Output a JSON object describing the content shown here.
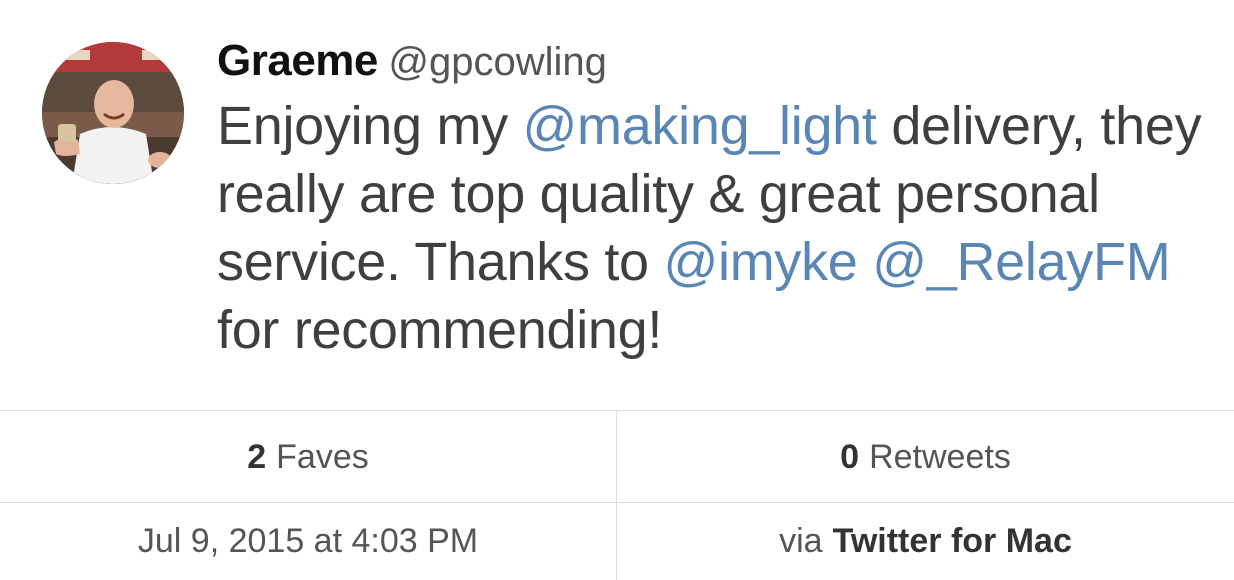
{
  "tweet": {
    "author": {
      "name": "Graeme",
      "handle": "@gpcowling"
    },
    "text": {
      "part1": "Enjoying my ",
      "mention1": "@making_light",
      "part2": " delivery, they really are top quality & great personal service. Thanks to ",
      "mention2": "@imyke",
      "part3": " ",
      "mention3": "@_RelayFM",
      "part4": " for recommending!"
    },
    "stats": {
      "faves_count": "2",
      "faves_label": "Faves",
      "retweets_count": "0",
      "retweets_label": "Retweets"
    },
    "meta": {
      "timestamp": "Jul 9, 2015 at 4:03 PM",
      "via_label": "via",
      "client": "Twitter for Mac"
    }
  },
  "colors": {
    "mention": "#5a86b6",
    "text": "#3f3f3f",
    "divider": "#dcdcdc"
  }
}
